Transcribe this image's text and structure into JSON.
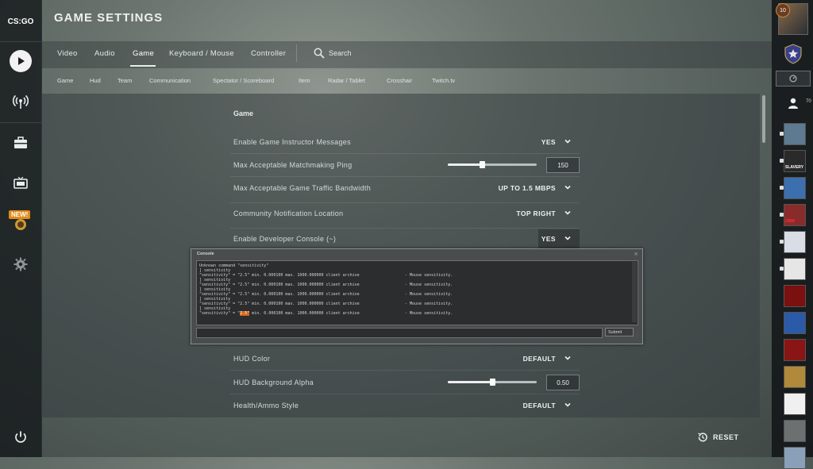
{
  "app": {
    "logo": "CS:GO",
    "page_title": "GAME SETTINGS"
  },
  "left_rail": {
    "items": [
      {
        "icon": "play-icon"
      },
      {
        "icon": "broadcast-icon"
      },
      {
        "icon": "inventory-icon"
      },
      {
        "icon": "tv-icon"
      },
      {
        "icon": "operation-icon",
        "badge": "NEW!"
      },
      {
        "icon": "gear-icon"
      }
    ],
    "power_icon": "power-icon"
  },
  "main_tabs": [
    {
      "label": "Video"
    },
    {
      "label": "Audio"
    },
    {
      "label": "Game",
      "active": true
    },
    {
      "label": "Keyboard / Mouse"
    },
    {
      "label": "Controller"
    }
  ],
  "search": {
    "label": "Search"
  },
  "sub_tabs": [
    "Game",
    "Hud",
    "Team",
    "Communication",
    "Spectator / Scoreboard",
    "Item",
    "Radar / Tablet",
    "Crosshair",
    "Twitch.tv"
  ],
  "section": {
    "heading": "Game"
  },
  "settings": [
    {
      "label": "Enable Game Instructor Messages",
      "value": "YES"
    },
    {
      "label": "Max Acceptable Matchmaking Ping",
      "value": "150",
      "slider_fraction": 0.38
    },
    {
      "label": "Max Acceptable Game Traffic Bandwidth",
      "value": "UP TO 1.5 MBPS"
    },
    {
      "label": "Community Notification Location",
      "value": "TOP RIGHT"
    },
    {
      "label": "Enable Developer Console (~)",
      "value": "YES"
    },
    {
      "label": "HUD Color",
      "value": "DEFAULT"
    },
    {
      "label": "HUD Background Alpha",
      "value": "0.50",
      "slider_fraction": 0.5
    },
    {
      "label": "Health/Ammo Style",
      "value": "DEFAULT"
    }
  ],
  "reset": {
    "label": "RESET"
  },
  "console": {
    "title": "Console",
    "close": "×",
    "lines": [
      "Unknown command \"sensitivity\"",
      "] sensitivity",
      "\"sensitivity\" = \"2.5\" min. 0.000100 max. 1000.000000 client archive",
      "] sensitivity",
      "\"sensitivity\" = \"2.5\" min. 0.000100 max. 1000.000000 client archive",
      "] sensitivity",
      "\"sensitivity\" = \"2.5\" min. 0.000100 max. 1000.000000 client archive",
      "] sensitivity",
      "\"sensitivity\" = \"2.5\" min. 0.000100 max. 1000.000000 client archive",
      "] sensitivity",
      "\"sensitivity\" = \"",
      "2.5\"",
      " min. 0.000100 max. 1000.000000 client archive"
    ],
    "desc": "- Mouse sensitivity.",
    "submit": "Submit"
  },
  "right_rail": {
    "level": "10",
    "friends_count": "70",
    "friend_avatar_colors": [
      "#5d7a90",
      "#2a2a2a",
      "#3c6fae",
      "#8a2b2b",
      "#d8dde6",
      "#e6e6e6",
      "#7a1010",
      "#2b5aa8",
      "#8a1515",
      "#b08a3a",
      "#f0f0f0",
      "#6c7070",
      "#8aa0b8"
    ],
    "friend_labels": [
      "",
      "SLAVERY",
      "",
      "ONIX",
      "",
      "",
      "",
      "",
      "",
      "",
      "",
      "",
      ""
    ]
  }
}
